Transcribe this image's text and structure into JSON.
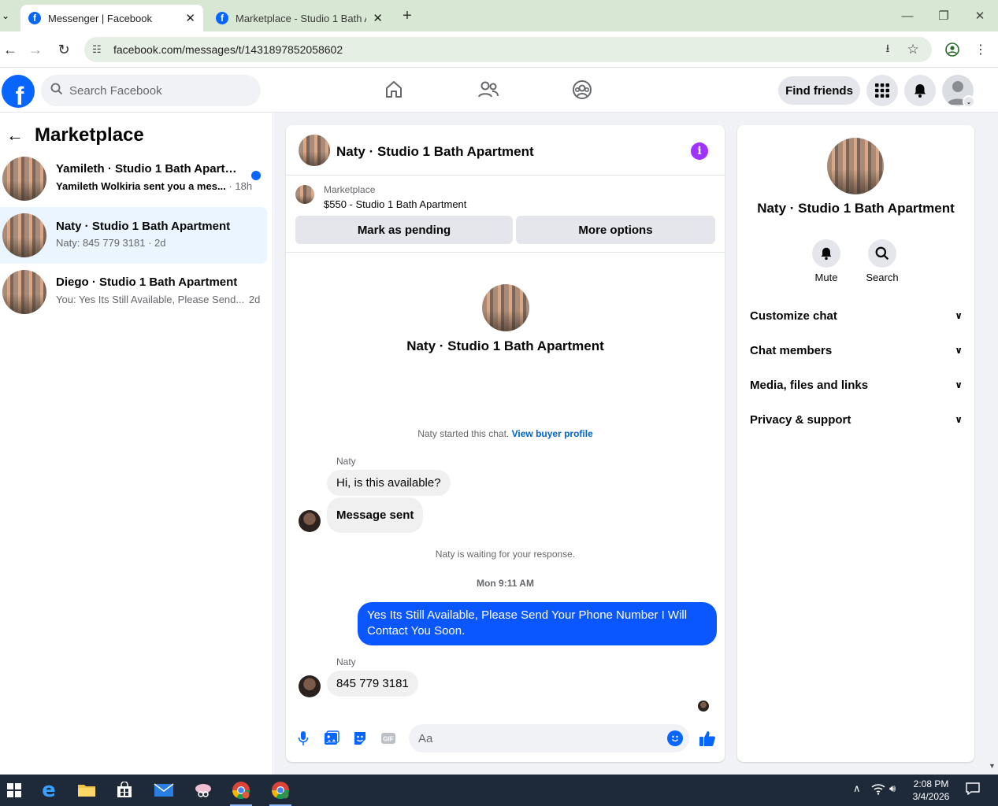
{
  "browser": {
    "tabs": [
      {
        "title": "Messenger | Facebook",
        "active": true
      },
      {
        "title": "Marketplace - Studio 1 Bath Ap",
        "active": false
      }
    ],
    "url": "facebook.com/messages/t/1431897852058602"
  },
  "header": {
    "search_placeholder": "Search Facebook",
    "find_friends": "Find friends"
  },
  "sidebar": {
    "title": "Marketplace",
    "conversations": [
      {
        "title": "Yamileth · Studio 1 Bath Apartme...",
        "preview": "Yamileth Wolkiria sent you a mes...",
        "time": "· 18h",
        "unread": true
      },
      {
        "title": "Naty · Studio 1 Bath Apartment",
        "preview": "Naty: 845 779 3181",
        "time": "· 2d",
        "unread": false,
        "selected": true
      },
      {
        "title": "Diego · Studio 1 Bath Apartment",
        "preview": "You: Yes Its Still Available, Please Send...",
        "time": "2d",
        "unread": false
      }
    ]
  },
  "chat": {
    "title": "Naty · Studio 1 Bath Apartment",
    "listing": {
      "source": "Marketplace",
      "price_title": "$550 - Studio 1 Bath Apartment",
      "btn_pending": "Mark as pending",
      "btn_more": "More options"
    },
    "intro_name": "Naty · Studio 1 Bath Apartment",
    "started_text": "Naty started this chat.",
    "buyer_link": "View buyer profile",
    "sender1": "Naty",
    "msg1": "Hi, is this available?",
    "msg2": "Message sent",
    "waiting": "Naty is waiting for your response.",
    "timestamp": "Mon 9:11 AM",
    "outgoing": "Yes Its Still Available, Please Send Your Phone Number I Will Contact You Soon.",
    "sender2": "Naty",
    "msg3": "845 779 3181",
    "composer_placeholder": "Aa"
  },
  "right_panel": {
    "name": "Naty · Studio 1 Bath Apartment",
    "mute": "Mute",
    "search": "Search",
    "sections": [
      "Customize chat",
      "Chat members",
      "Media, files and links",
      "Privacy & support"
    ]
  },
  "taskbar": {
    "time": "2:08 PM",
    "date": "3/4/2026"
  },
  "colors": {
    "fb_blue": "#0866ff",
    "outgoing_bubble": "#0a56ff",
    "info_purple": "#a033ff",
    "selected_row": "#ebf5ff"
  }
}
